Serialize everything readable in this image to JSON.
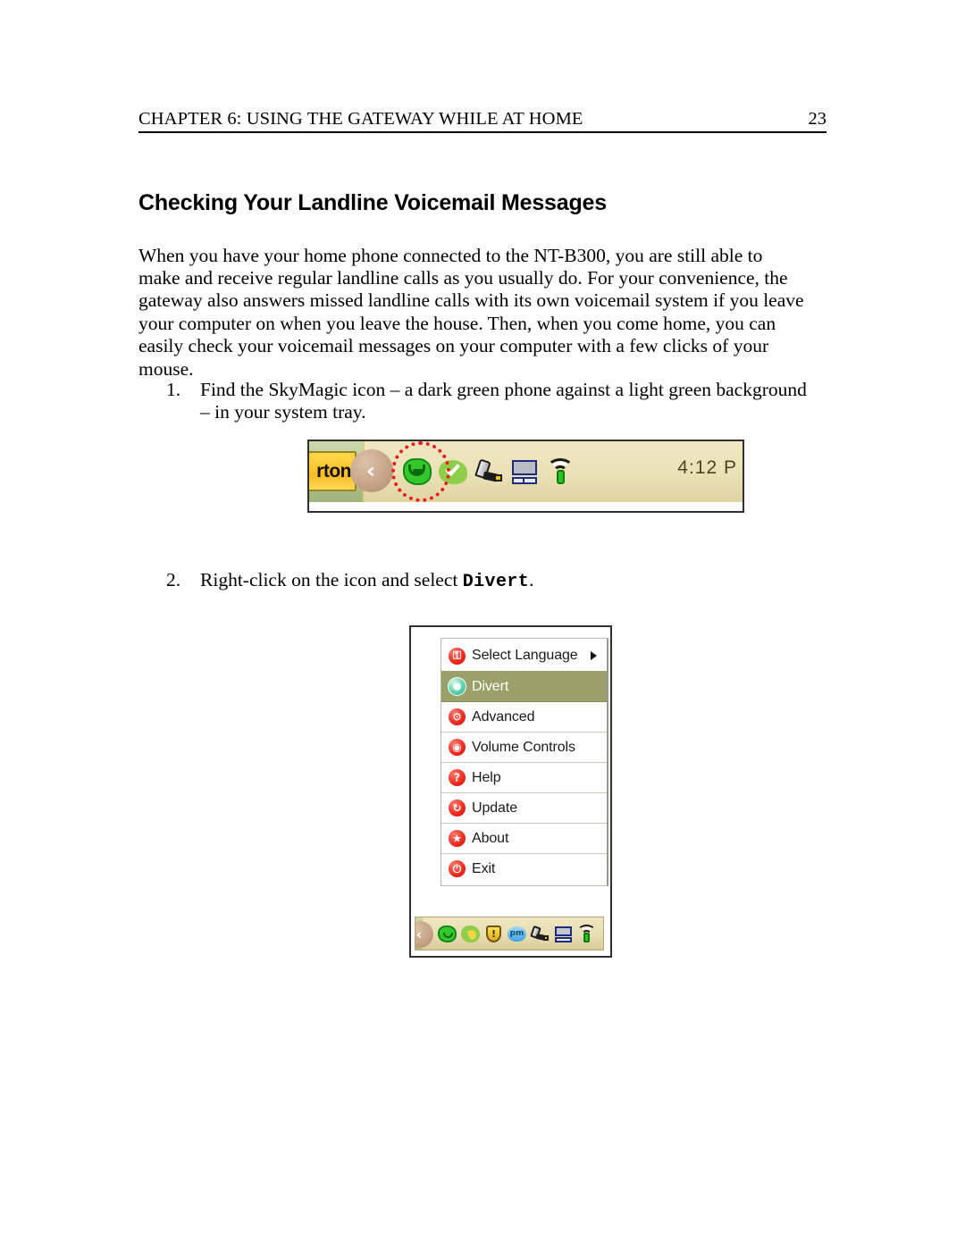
{
  "header": {
    "chapter_title": "CHAPTER 6: USING THE GATEWAY WHILE AT HOME",
    "page_number": "23"
  },
  "heading": "Checking Your Landline Voicemail Messages",
  "paragraph": "When you have your home phone connected to the NT-B300, you are still able to make and receive regular landline calls as you usually do. For your convenience, the gateway also answers missed landline calls with its own voicemail system if you leave your computer on when you leave the house. Then, when you come home, you can easily check your voicemail messages on your computer with a few clicks of your mouse.",
  "steps": [
    {
      "number": "1.",
      "text": "Find the SkyMagic icon – a dark green phone against a light green background – in your system tray."
    },
    {
      "number": "2.",
      "text_before": "Right-click on the icon and select ",
      "emphasis": "Divert",
      "text_after": "."
    }
  ],
  "figure_tray": {
    "norton_label": "rton",
    "clock": "4:12 P",
    "expander_glyph": "‹",
    "icons": [
      {
        "name": "skymagic-phone-icon",
        "highlighted": true
      },
      {
        "name": "green-check-icon",
        "highlighted": false
      },
      {
        "name": "usb-cable-icon",
        "highlighted": false
      },
      {
        "name": "monitor-icon",
        "highlighted": false
      },
      {
        "name": "wireless-signal-icon",
        "highlighted": false
      }
    ]
  },
  "figure_menu": {
    "items": [
      {
        "label": "Select Language",
        "icon": "key-icon",
        "icon_glyph": "⚿",
        "icon_color": "red",
        "has_submenu": true,
        "selected": false
      },
      {
        "label": "Divert",
        "icon": "divert-icon",
        "icon_glyph": "●",
        "icon_color": "teal",
        "has_submenu": false,
        "selected": true
      },
      {
        "label": "Advanced",
        "icon": "gear-icon",
        "icon_glyph": "⚙",
        "icon_color": "red",
        "has_submenu": false,
        "selected": false
      },
      {
        "label": "Volume Controls",
        "icon": "speaker-icon",
        "icon_glyph": "◉",
        "icon_color": "red",
        "has_submenu": false,
        "selected": false
      },
      {
        "label": "Help",
        "icon": "question-icon",
        "icon_glyph": "?",
        "icon_color": "red",
        "has_submenu": false,
        "selected": false
      },
      {
        "label": "Update",
        "icon": "refresh-icon",
        "icon_glyph": "↻",
        "icon_color": "red",
        "has_submenu": false,
        "selected": false
      },
      {
        "label": "About",
        "icon": "star-icon",
        "icon_glyph": "★",
        "icon_color": "red",
        "has_submenu": false,
        "selected": false
      },
      {
        "label": "Exit",
        "icon": "power-icon",
        "icon_glyph": "⏻",
        "icon_color": "red",
        "has_submenu": false,
        "selected": false
      }
    ],
    "taskbar": {
      "expander_glyph": "‹",
      "shield_glyph": "!",
      "pm_label": "pm",
      "icons": [
        "skymagic-phone-icon",
        "moon-status-icon",
        "warning-shield-icon",
        "pm-icon",
        "usb-cable-icon",
        "monitor-icon",
        "wireless-signal-icon"
      ]
    }
  },
  "colors": {
    "menu_highlight": "#9aa06a",
    "taskbar_green": "#bccb99",
    "tray_beige": "#eae1b6",
    "norton_gold": "#fcc631",
    "highlight_ring": "#ee1b1b",
    "icon_red": "#ee2b20",
    "icon_teal": "#2fae86"
  }
}
